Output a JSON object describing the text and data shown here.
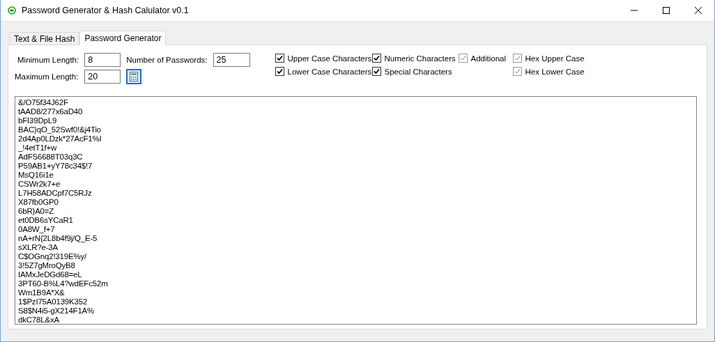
{
  "window": {
    "title": "Password Generator & Hash Calulator v0.1"
  },
  "tabs": [
    {
      "label": "Text & File Hash",
      "selected": false
    },
    {
      "label": "Password Generator",
      "selected": true
    }
  ],
  "fields": [
    {
      "label": "Minimum Length:",
      "value": "8"
    },
    {
      "label": "Maximum Length:",
      "value": "20"
    },
    {
      "label": "Number of Passwords:",
      "value": "25"
    }
  ],
  "options": [
    {
      "label": "Upper Case Characters",
      "checked": true,
      "disabled": false
    },
    {
      "label": "Lower Case Characters",
      "checked": true,
      "disabled": false
    },
    {
      "label": "Numeric Characters",
      "checked": true,
      "disabled": false
    },
    {
      "label": "Special Characters",
      "checked": true,
      "disabled": false
    },
    {
      "label": "Additional",
      "checked": true,
      "disabled": true
    },
    {
      "label": "Hex Upper Case",
      "checked": true,
      "disabled": true
    },
    {
      "label": "Hex Lower Case",
      "checked": true,
      "disabled": true
    }
  ],
  "passwords": [
    "&/O75f34J62F",
    "tAAD8/277x6aD40",
    "bFI39DpL9",
    "BAC}qO_52Swf0!&j4Tio",
    "2d4Ap0LDzk*27AcF1%I",
    "_!4etT1f+w",
    "AdFS6688T03q3C",
    "P59AB1+yY78c34$!7",
    "MsQ16i1e",
    "CSWr2k7+e",
    "L7H58ADCpf7C5RJz",
    "X87fb0GP0",
    "6bR}A0=Z",
    "et0DB6sYCaR1",
    "0A8W_f+7",
    "nA+rN{2L8b4f9j/Q_E-5",
    "sXLR?e-3A",
    "C$OGnq2!319E%y/",
    "3!5Z7gMroQyB8",
    "IAMxJeDGd68=eL",
    "3PT60-B%L4?wdEFc52m",
    "Wm1B9A*X&",
    "1$PzI75A0139K352",
    "S8$N4i5-gX214F1A%",
    "dkC78L&xA"
  ]
}
